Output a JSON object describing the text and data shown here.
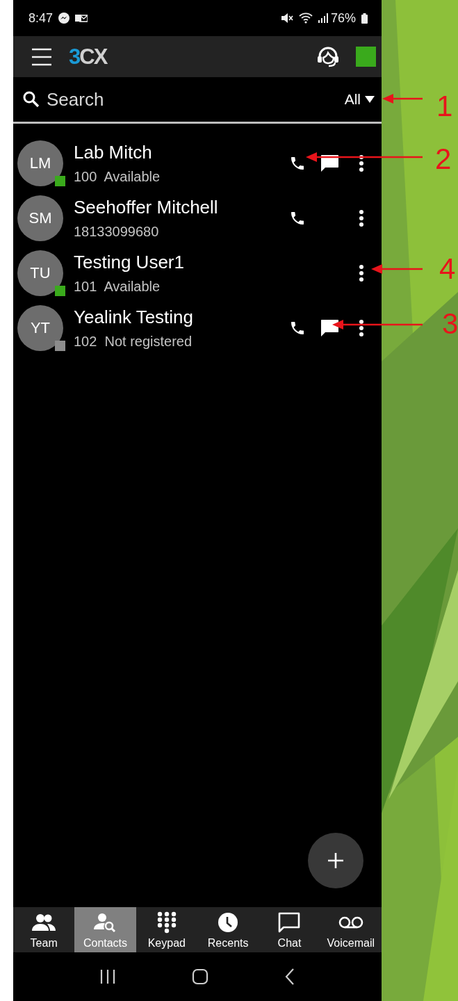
{
  "status_bar": {
    "time": "8:47",
    "battery": "76%"
  },
  "app_bar": {
    "logo": "3CX"
  },
  "search": {
    "placeholder": "Search",
    "filter": "All"
  },
  "contacts": [
    {
      "initials": "LM",
      "name": "Lab Mitch",
      "number": "100",
      "status": "Available",
      "color": "#3aaa1c",
      "actions": [
        {
          "kind": "call"
        },
        {
          "kind": "chat"
        },
        {
          "kind": "more"
        }
      ]
    },
    {
      "initials": "SM",
      "name": "Seehoffer Mitchell",
      "number": "18133099680",
      "actions": [
        {
          "kind": "call"
        },
        {
          "kind": "more"
        }
      ]
    },
    {
      "initials": "TU",
      "name": "Testing User1",
      "number": "101",
      "status": "Available",
      "color": "#3aaa1c",
      "actions": [
        {
          "kind": "more"
        }
      ]
    },
    {
      "initials": "YT",
      "name": "Yealink Testing",
      "number": "102",
      "status": "Not registered",
      "color": "#8c8c8c",
      "actions": [
        {
          "kind": "call"
        },
        {
          "kind": "chat"
        },
        {
          "kind": "more"
        }
      ]
    }
  ],
  "tabs": [
    {
      "label": "Team",
      "kind": "team",
      "selected": false
    },
    {
      "label": "Contacts",
      "kind": "contacts",
      "selected": true
    },
    {
      "label": "Keypad",
      "kind": "keypad",
      "selected": false
    },
    {
      "label": "Recents",
      "kind": "recents",
      "selected": false
    },
    {
      "label": "Chat",
      "kind": "chat",
      "selected": false
    },
    {
      "label": "Voicemail",
      "kind": "voicemail",
      "selected": false
    }
  ],
  "callouts": [
    {
      "number": "1"
    },
    {
      "number": "2"
    },
    {
      "number": "4"
    },
    {
      "number": "3"
    }
  ]
}
